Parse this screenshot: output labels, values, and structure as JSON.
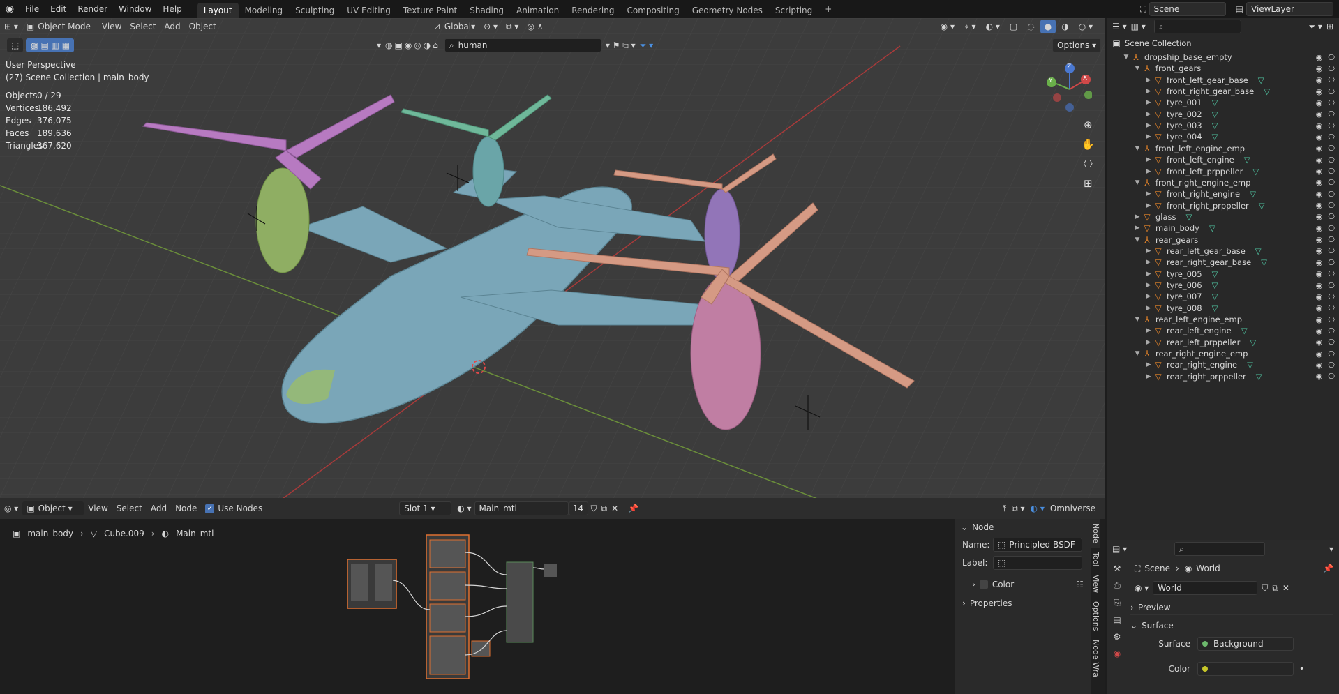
{
  "topbar": {
    "menu": [
      "File",
      "Edit",
      "Render",
      "Window",
      "Help"
    ],
    "workspaces": [
      "Layout",
      "Modeling",
      "Sculpting",
      "UV Editing",
      "Texture Paint",
      "Shading",
      "Animation",
      "Rendering",
      "Compositing",
      "Geometry Nodes",
      "Scripting"
    ],
    "active_workspace": "Layout",
    "add_tab": "+",
    "scene": "Scene",
    "view_layer": "ViewLayer"
  },
  "viewport": {
    "mode": "Object Mode",
    "menus": [
      "View",
      "Select",
      "Add",
      "Object"
    ],
    "orientation": "Global",
    "search_value": "human",
    "options_label": "Options",
    "perspective": "User Perspective",
    "collection_info": "(27) Scene Collection | main_body",
    "stats": [
      {
        "label": "Objects",
        "value": "0 / 29"
      },
      {
        "label": "Vertices",
        "value": "186,492"
      },
      {
        "label": "Edges",
        "value": "376,075"
      },
      {
        "label": "Faces",
        "value": "189,636"
      },
      {
        "label": "Triangles",
        "value": "367,620"
      }
    ],
    "gizmo_axes": {
      "x": "X",
      "y": "Y",
      "z": "Z"
    }
  },
  "outliner": {
    "root": "Scene Collection",
    "items": [
      {
        "name": "dropship_base_empty",
        "depth": 1,
        "expanded": true,
        "kind": "empty"
      },
      {
        "name": "front_gears",
        "depth": 2,
        "expanded": true,
        "kind": "empty"
      },
      {
        "name": "front_left_gear_base",
        "depth": 3,
        "expanded": false,
        "kind": "mesh"
      },
      {
        "name": "front_right_gear_base",
        "depth": 3,
        "expanded": false,
        "kind": "mesh"
      },
      {
        "name": "tyre_001",
        "depth": 3,
        "expanded": false,
        "kind": "mesh"
      },
      {
        "name": "tyre_002",
        "depth": 3,
        "expanded": false,
        "kind": "mesh"
      },
      {
        "name": "tyre_003",
        "depth": 3,
        "expanded": false,
        "kind": "mesh"
      },
      {
        "name": "tyre_004",
        "depth": 3,
        "expanded": false,
        "kind": "mesh"
      },
      {
        "name": "front_left_engine_emp",
        "depth": 2,
        "expanded": true,
        "kind": "empty"
      },
      {
        "name": "front_left_engine",
        "depth": 3,
        "expanded": false,
        "kind": "mesh"
      },
      {
        "name": "front_left_prppeller",
        "depth": 3,
        "expanded": false,
        "kind": "mesh"
      },
      {
        "name": "front_right_engine_emp",
        "depth": 2,
        "expanded": true,
        "kind": "empty"
      },
      {
        "name": "front_right_engine",
        "depth": 3,
        "expanded": false,
        "kind": "mesh"
      },
      {
        "name": "front_right_prppeller",
        "depth": 3,
        "expanded": false,
        "kind": "mesh"
      },
      {
        "name": "glass",
        "depth": 2,
        "expanded": false,
        "kind": "mesh"
      },
      {
        "name": "main_body",
        "depth": 2,
        "expanded": false,
        "kind": "mesh"
      },
      {
        "name": "rear_gears",
        "depth": 2,
        "expanded": true,
        "kind": "empty"
      },
      {
        "name": "rear_left_gear_base",
        "depth": 3,
        "expanded": false,
        "kind": "mesh"
      },
      {
        "name": "rear_right_gear_base",
        "depth": 3,
        "expanded": false,
        "kind": "mesh"
      },
      {
        "name": "tyre_005",
        "depth": 3,
        "expanded": false,
        "kind": "mesh"
      },
      {
        "name": "tyre_006",
        "depth": 3,
        "expanded": false,
        "kind": "mesh"
      },
      {
        "name": "tyre_007",
        "depth": 3,
        "expanded": false,
        "kind": "mesh"
      },
      {
        "name": "tyre_008",
        "depth": 3,
        "expanded": false,
        "kind": "mesh"
      },
      {
        "name": "rear_left_engine_emp",
        "depth": 2,
        "expanded": true,
        "kind": "empty"
      },
      {
        "name": "rear_left_engine",
        "depth": 3,
        "expanded": false,
        "kind": "mesh"
      },
      {
        "name": "rear_left_prppeller",
        "depth": 3,
        "expanded": false,
        "kind": "mesh"
      },
      {
        "name": "rear_right_engine_emp",
        "depth": 2,
        "expanded": true,
        "kind": "empty"
      },
      {
        "name": "rear_right_engine",
        "depth": 3,
        "expanded": false,
        "kind": "mesh"
      },
      {
        "name": "rear_right_prppeller",
        "depth": 3,
        "expanded": false,
        "kind": "mesh"
      }
    ]
  },
  "node_editor": {
    "type": "Object",
    "menus": [
      "View",
      "Select",
      "Add",
      "Node"
    ],
    "use_nodes_label": "Use Nodes",
    "slot": "Slot 1",
    "material": "Main_mtl",
    "users": "14",
    "renderer_label": "Omniverse",
    "breadcrumb": [
      "main_body",
      "Cube.009",
      "Main_mtl"
    ]
  },
  "n_panel": {
    "section": "Node",
    "name_label": "Name:",
    "name_value": "Principled BSDF",
    "label_label": "Label:",
    "label_value": "",
    "color_label": "Color",
    "properties_label": "Properties",
    "tabs": [
      "Node",
      "Tool",
      "View",
      "Options",
      "Node Wra"
    ]
  },
  "properties": {
    "breadcrumb": [
      "Scene",
      "World"
    ],
    "world_name": "World",
    "preview_label": "Preview",
    "surface_section": "Surface",
    "surface_label": "Surface",
    "surface_value": "Background",
    "color_label": "Color"
  },
  "colors": {
    "accent": "#4772b3",
    "mesh_icon": "#e8862a",
    "mesh_data": "#4fc3a1",
    "body": "#7aa6b8",
    "engine_green": "#8fae63",
    "engine_teal": "#6aa5a8",
    "engine_purple": "#9275b8",
    "engine_pink": "#c07ea3",
    "prop_purple": "#b77ac1",
    "prop_teal": "#6fb89a",
    "prop_salmon": "#d59a84"
  }
}
